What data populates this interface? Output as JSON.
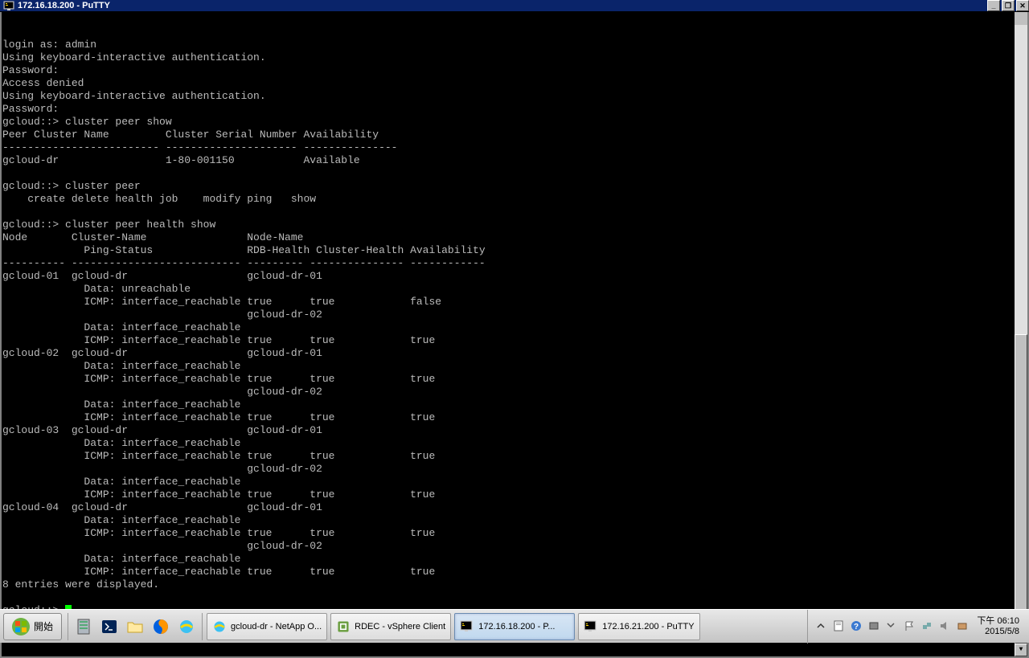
{
  "titlebar": {
    "title": "172.16.18.200 - PuTTY"
  },
  "terminal_lines": [
    "login as: admin",
    "Using keyboard-interactive authentication.",
    "Password:",
    "Access denied",
    "Using keyboard-interactive authentication.",
    "Password:",
    "gcloud::> cluster peer show",
    "Peer Cluster Name         Cluster Serial Number Availability",
    "------------------------- --------------------- ---------------",
    "gcloud-dr                 1-80-001150           Available",
    "",
    "gcloud::> cluster peer",
    "    create delete health job    modify ping   show",
    "",
    "gcloud::> cluster peer health show",
    "Node       Cluster-Name                Node-Name",
    "             Ping-Status               RDB-Health Cluster-Health Availability",
    "---------- --------------------------- --------- --------------- ------------",
    "gcloud-01  gcloud-dr                   gcloud-dr-01",
    "             Data: unreachable",
    "             ICMP: interface_reachable true      true            false",
    "                                       gcloud-dr-02",
    "             Data: interface_reachable",
    "             ICMP: interface_reachable true      true            true",
    "gcloud-02  gcloud-dr                   gcloud-dr-01",
    "             Data: interface_reachable",
    "             ICMP: interface_reachable true      true            true",
    "                                       gcloud-dr-02",
    "             Data: interface_reachable",
    "             ICMP: interface_reachable true      true            true",
    "gcloud-03  gcloud-dr                   gcloud-dr-01",
    "             Data: interface_reachable",
    "             ICMP: interface_reachable true      true            true",
    "                                       gcloud-dr-02",
    "             Data: interface_reachable",
    "             ICMP: interface_reachable true      true            true",
    "gcloud-04  gcloud-dr                   gcloud-dr-01",
    "             Data: interface_reachable",
    "             ICMP: interface_reachable true      true            true",
    "                                       gcloud-dr-02",
    "             Data: interface_reachable",
    "             ICMP: interface_reachable true      true            true",
    "8 entries were displayed.",
    "",
    "gcloud::> "
  ],
  "taskbar": {
    "start": "開始",
    "tasks": [
      {
        "label": "gcloud-dr - NetApp O...",
        "icon": "ie"
      },
      {
        "label": "RDEC - vSphere Client",
        "icon": "vsphere"
      },
      {
        "label": "172.16.18.200 - P...",
        "icon": "putty",
        "active": true
      },
      {
        "label": "172.16.21.200 - PuTTY",
        "icon": "putty"
      }
    ],
    "time": "下午 06:10",
    "date": "2015/5/8"
  }
}
